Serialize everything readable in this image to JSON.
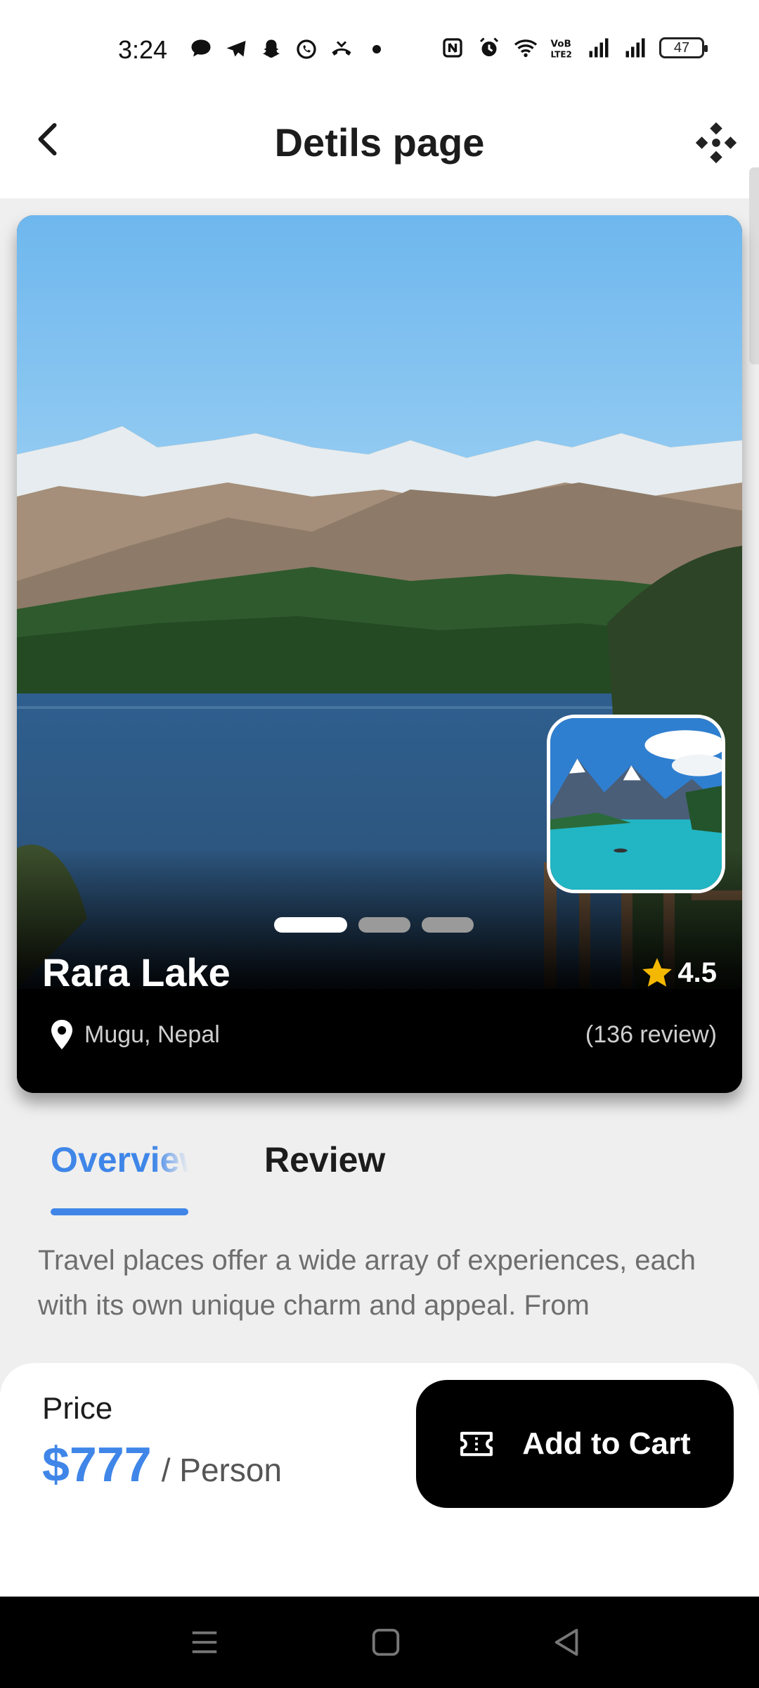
{
  "status_bar": {
    "time": "3:24",
    "battery": "47"
  },
  "header": {
    "title": "Detils page"
  },
  "place": {
    "name": "Rara Lake",
    "rating": "4.5",
    "location": "Mugu, Nepal",
    "reviews": "(136 review)",
    "carousel": {
      "count": 3,
      "active_index": 0
    }
  },
  "tabs": [
    {
      "label": "Overview",
      "active": true
    },
    {
      "label": "Review",
      "active": false
    }
  ],
  "overview": {
    "text": "Travel places offer a wide array of experiences, each with its own unique charm and appeal. From"
  },
  "booking": {
    "price_label": "Price",
    "price": "$777",
    "unit": "/ Person",
    "cart_label": "Add to Cart"
  },
  "colors": {
    "accent": "#3f86e8",
    "star": "#f5b800",
    "button": "#000000"
  }
}
